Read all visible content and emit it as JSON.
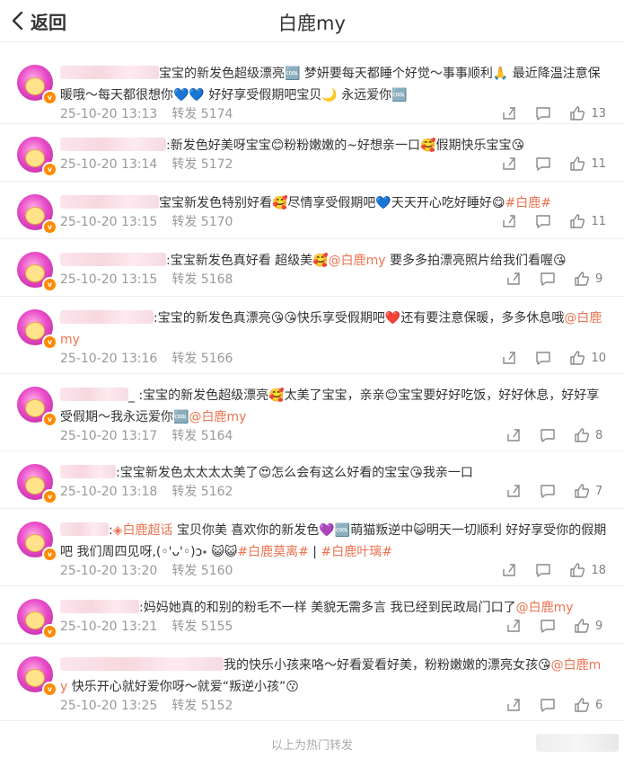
{
  "header": {
    "back_label": "返回",
    "title": "白鹿my"
  },
  "footer": "以上为热门转发",
  "comments": [
    {
      "blur_w": 110,
      "text": "宝宝的新发色超级漂亮🆒 梦妍要每天都睡个好觉～事事顺利🙏 最近降温注意保暖哦～每天都很想你💙💙 好好享受假期吧宝贝🌙 永远爱你🆒",
      "time": "25-10-20 13:13",
      "repost": "转发 5174",
      "likes": "13"
    },
    {
      "blur_w": 118,
      "text": ":新发色好美呀宝宝😊粉粉嫩嫩的~好想亲一口🥰假期快乐宝宝😘",
      "time": "25-10-20 13:14",
      "repost": "转发 5172",
      "likes": "11"
    },
    {
      "blur_w": 110,
      "text": "宝宝新发色特别好看🥰尽情享受假期吧💙天天开心吃好睡好😋",
      "tag": "#白鹿#",
      "time": "25-10-20 13:15",
      "repost": "转发 5170",
      "likes": "11"
    },
    {
      "blur_w": 118,
      "text": ":宝宝新发色真好看 超级美🥰",
      "mention": "@白鹿my",
      "text2": " 要多多拍漂亮照片给我们看喔😘",
      "time": "25-10-20 13:15",
      "repost": "转发 5168",
      "likes": "9"
    },
    {
      "blur_w": 104,
      "text": ":宝宝的新发色真漂亮😘😘快乐享受假期吧❤️还有要注意保暖，多多休息哦",
      "mention": "@白鹿my",
      "time": "25-10-20 13:16",
      "repost": "转发 5166",
      "likes": "10"
    },
    {
      "blur_w": 76,
      "text": "_ :宝宝的新发色超级漂亮🥰太美了宝宝，亲亲😊宝宝要好好吃饭，好好休息，好好享受假期～我永远爱你🆒",
      "mention": "@白鹿my",
      "time": "25-10-20 13:17",
      "repost": "转发 5164",
      "likes": "8"
    },
    {
      "blur_w": 62,
      "text": ":宝宝新发色太太太太美了😍怎么会有这么好看的宝宝😘我亲一口",
      "time": "25-10-20 13:18",
      "repost": "转发 5162",
      "likes": "7"
    },
    {
      "blur_w": 54,
      "prefix": ":",
      "supertopic": "白鹿超话",
      "text": " 宝贝你美 喜欢你的新发色💜🆒萌猫叛逆中😺明天一切顺利 好好享受你的假期吧 我们周四见呀,(◦'ᴗ'◦)ↄ˖ 😺😺",
      "tag": "#白鹿莫离#",
      "tag2": "#白鹿叶璃#",
      "time": "25-10-20 13:20",
      "repost": "转发 5160",
      "likes": "18"
    },
    {
      "blur_w": 88,
      "text": ":妈妈她真的和别的粉毛不一样 美貌无需多言 我已经到民政局门口了",
      "mention": "@白鹿my",
      "time": "25-10-20 13:21",
      "repost": "转发 5155",
      "likes": "9"
    },
    {
      "blur_w": 182,
      "text": "我的快乐小孩来咯～好看爱看好美，粉粉嫩嫩的漂亮女孩😘",
      "mention": "@白鹿my",
      "text2": " 快乐开心就好爱你呀～就爱“叛逆小孩”😗",
      "time": "25-10-20 13:25",
      "repost": "转发 5152",
      "likes": "6"
    }
  ]
}
